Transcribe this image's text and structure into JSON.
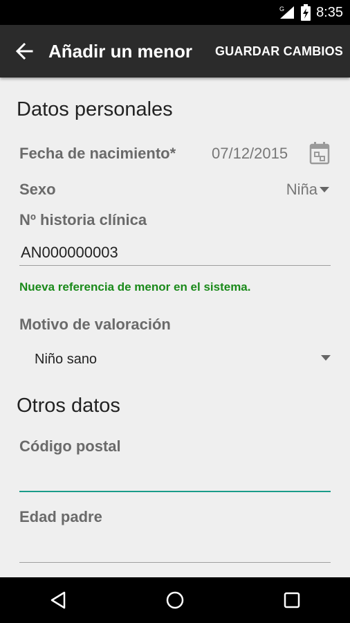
{
  "status_bar": {
    "time": "8:35"
  },
  "app_bar": {
    "title": "Añadir un menor",
    "save_label": "GUARDAR CAMBIOS"
  },
  "personal": {
    "section_title": "Datos personales",
    "birth_label": "Fecha de nacimiento*",
    "birth_value": "07/12/2015",
    "sex_label": "Sexo",
    "sex_value": "Niña",
    "history_label": "Nº historia clínica",
    "history_value": "AN000000003",
    "history_helper": "Nueva referencia de menor en el sistema.",
    "motive_label": "Motivo de valoración",
    "motive_value": "Niño sano"
  },
  "other": {
    "section_title": "Otros datos",
    "postal_label": "Código postal",
    "postal_value": "",
    "father_age_label": "Edad padre",
    "father_age_value": ""
  },
  "icons": {
    "back": "arrow-left-icon",
    "calendar": "calendar-icon",
    "dropdown": "triangle-down-icon",
    "wifi": "wifi-icon",
    "battery": "battery-charging-icon",
    "nav_back": "nav-back-icon",
    "nav_home": "nav-home-icon",
    "nav_recents": "nav-recents-icon"
  },
  "colors": {
    "accent": "#1a9c89",
    "success": "#1a8a1a",
    "app_bar": "#2b2b2b"
  }
}
